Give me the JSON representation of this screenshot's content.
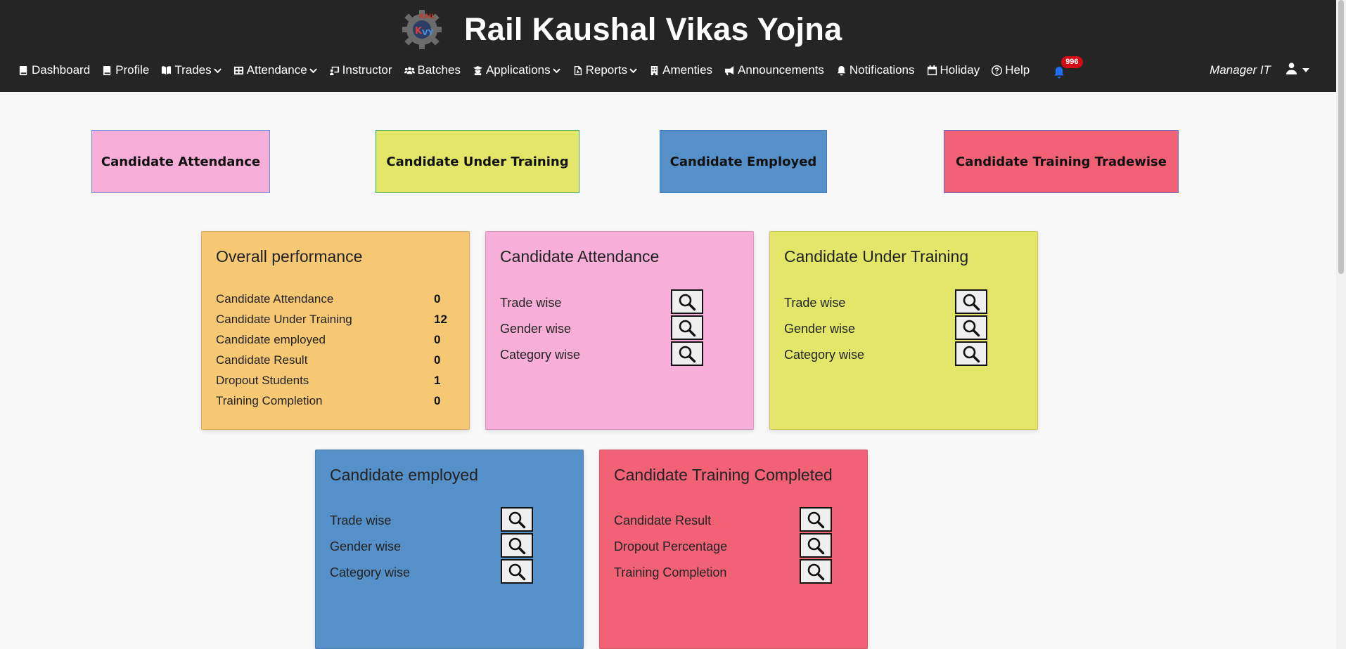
{
  "app": {
    "title": "Rail Kaushal Vikas Yojna",
    "logo_text": "RAIL KVY"
  },
  "nav": {
    "items": [
      {
        "label": "Dashboard",
        "icon": "book-icon",
        "dropdown": false
      },
      {
        "label": "Profile",
        "icon": "book-icon",
        "dropdown": false
      },
      {
        "label": "Trades",
        "icon": "open-book-icon",
        "dropdown": true
      },
      {
        "label": "Attendance",
        "icon": "table-icon",
        "dropdown": true
      },
      {
        "label": "Instructor",
        "icon": "instructor-icon",
        "dropdown": false
      },
      {
        "label": "Batches",
        "icon": "users-icon",
        "dropdown": false
      },
      {
        "label": "Applications",
        "icon": "graduate-icon",
        "dropdown": true
      },
      {
        "label": "Reports",
        "icon": "pdf-file-icon",
        "dropdown": true
      },
      {
        "label": "Amenties",
        "icon": "building-icon",
        "dropdown": false
      },
      {
        "label": "Announcements",
        "icon": "megaphone-icon",
        "dropdown": false
      },
      {
        "label": "Notifications",
        "icon": "bell-icon",
        "dropdown": false
      },
      {
        "label": "Holiday",
        "icon": "calendar-icon",
        "dropdown": false
      },
      {
        "label": "Help",
        "icon": "question-circle-icon",
        "dropdown": false
      }
    ],
    "notification_count": "996",
    "user_name": "Manager IT"
  },
  "top_buttons": [
    {
      "label": "Candidate Attendance",
      "color": "#f7aed9",
      "border": "#5b8fd6"
    },
    {
      "label": "Candidate Under Training",
      "color": "#e3e668",
      "border": "#3aa56a"
    },
    {
      "label": "Candidate Employed",
      "color": "#5591c8",
      "border": "#3d7abf"
    },
    {
      "label": "Candidate Training Tradewise",
      "color": "#f26277",
      "border": "#5b6fc8"
    }
  ],
  "overall": {
    "title": "Overall performance",
    "color": "#f7c874",
    "rows": [
      {
        "label": "Candidate Attendance",
        "value": "0"
      },
      {
        "label": "Candidate Under Training",
        "value": "12"
      },
      {
        "label": "Candidate employed",
        "value": "0"
      },
      {
        "label": "Candidate Result",
        "value": "0"
      },
      {
        "label": "Dropout Students",
        "value": "1"
      },
      {
        "label": "Training Completion",
        "value": "0"
      }
    ]
  },
  "cards": [
    {
      "title": "Candidate Attendance",
      "color": "#f7aed9",
      "rows": [
        "Trade wise",
        "Gender wise",
        "Category wise"
      ]
    },
    {
      "title": "Candidate Under Training",
      "color": "#e3e668",
      "rows": [
        "Trade wise",
        "Gender wise",
        "Category wise"
      ]
    },
    {
      "title": "Candidate employed",
      "color": "#5591c8",
      "rows": [
        "Trade wise",
        "Gender wise",
        "Category wise"
      ]
    },
    {
      "title": "Candidate Training Completed",
      "color": "#f26277",
      "rows": [
        "Candidate Result",
        "Dropout Percentage",
        "Training Completion"
      ]
    }
  ]
}
